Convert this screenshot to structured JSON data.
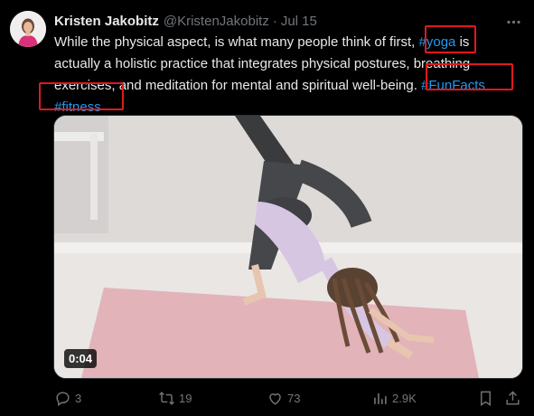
{
  "author": {
    "name": "Kristen Jakobitz",
    "handle": "@KristenJakobitz",
    "separator": "·",
    "date": "Jul 15"
  },
  "tweet": {
    "line1": "While the physical aspect, is what many people think of first, ",
    "hashtag_yoga": "#yoga",
    "line1_end": " is",
    "line2": "actually a holistic practice that integrates physical postures, breathing",
    "line3": "exercises, and meditation for mental and spiritual well-being. ",
    "hashtag_funfacts": "#FunFacts",
    "hashtag_fitness": "#fitness"
  },
  "media": {
    "duration": "0:04"
  },
  "actions": {
    "replies": "3",
    "reposts": "19",
    "likes": "73",
    "views": "2.9K"
  },
  "colors": {
    "background": "#000000",
    "text": "#e7e9ea",
    "muted": "#71767b",
    "link": "#1d9bf0",
    "highlight": "#e0191b"
  },
  "icons": [
    "more-icon",
    "reply-icon",
    "repost-icon",
    "like-icon",
    "views-icon",
    "bookmark-icon",
    "share-icon"
  ]
}
